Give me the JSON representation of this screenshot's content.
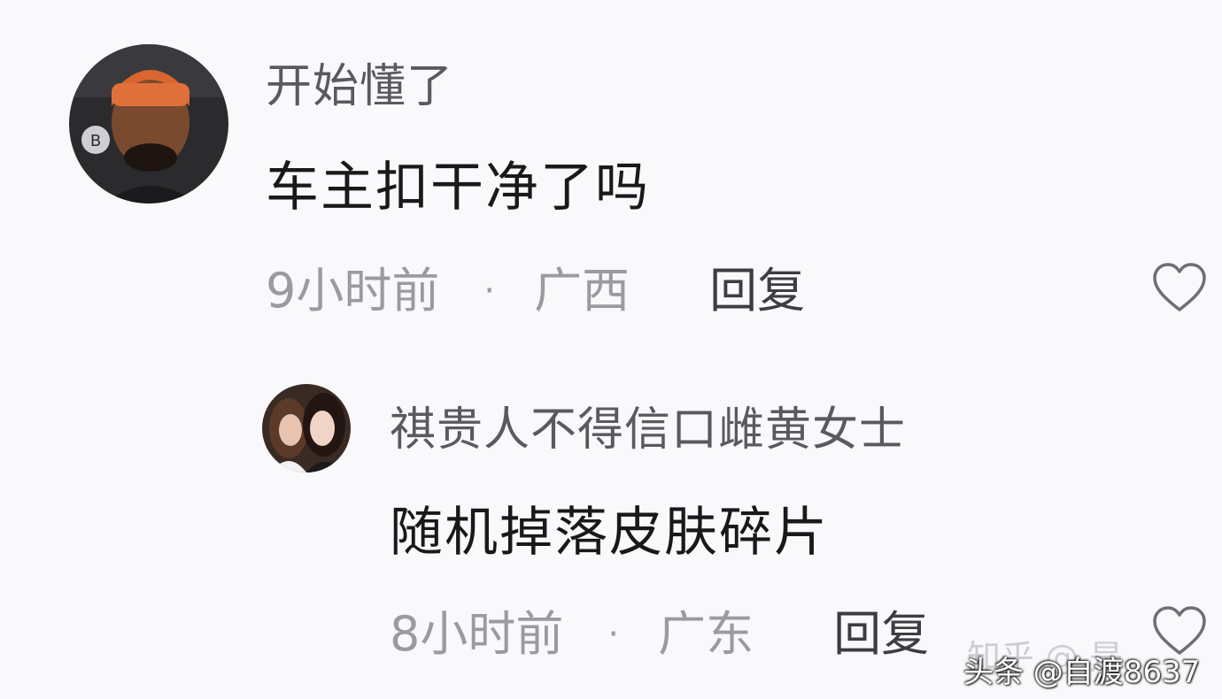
{
  "comments": [
    {
      "username": "开始懂了",
      "content": "车主扣干净了吗",
      "time": "9小时前",
      "separator": "·",
      "location": "广西",
      "reply_label": "回复"
    },
    {
      "username": "祺贵人不得信口雌黄女士",
      "content": "随机掉落皮肤碎片",
      "time": "8小时前",
      "separator": "·",
      "location": "广东",
      "reply_label": "回复"
    }
  ],
  "watermarks": {
    "faint": "知乎 @ 是",
    "main": "头条 @自渡8637"
  },
  "colors": {
    "background": "#f9f9fb",
    "username": "#5a5a5e",
    "content": "#19191b",
    "meta": "#9a9aa0",
    "reply": "#3d3d41",
    "heart_outline": "#6e6e74"
  },
  "icons": {
    "like": "heart-outline-icon"
  }
}
